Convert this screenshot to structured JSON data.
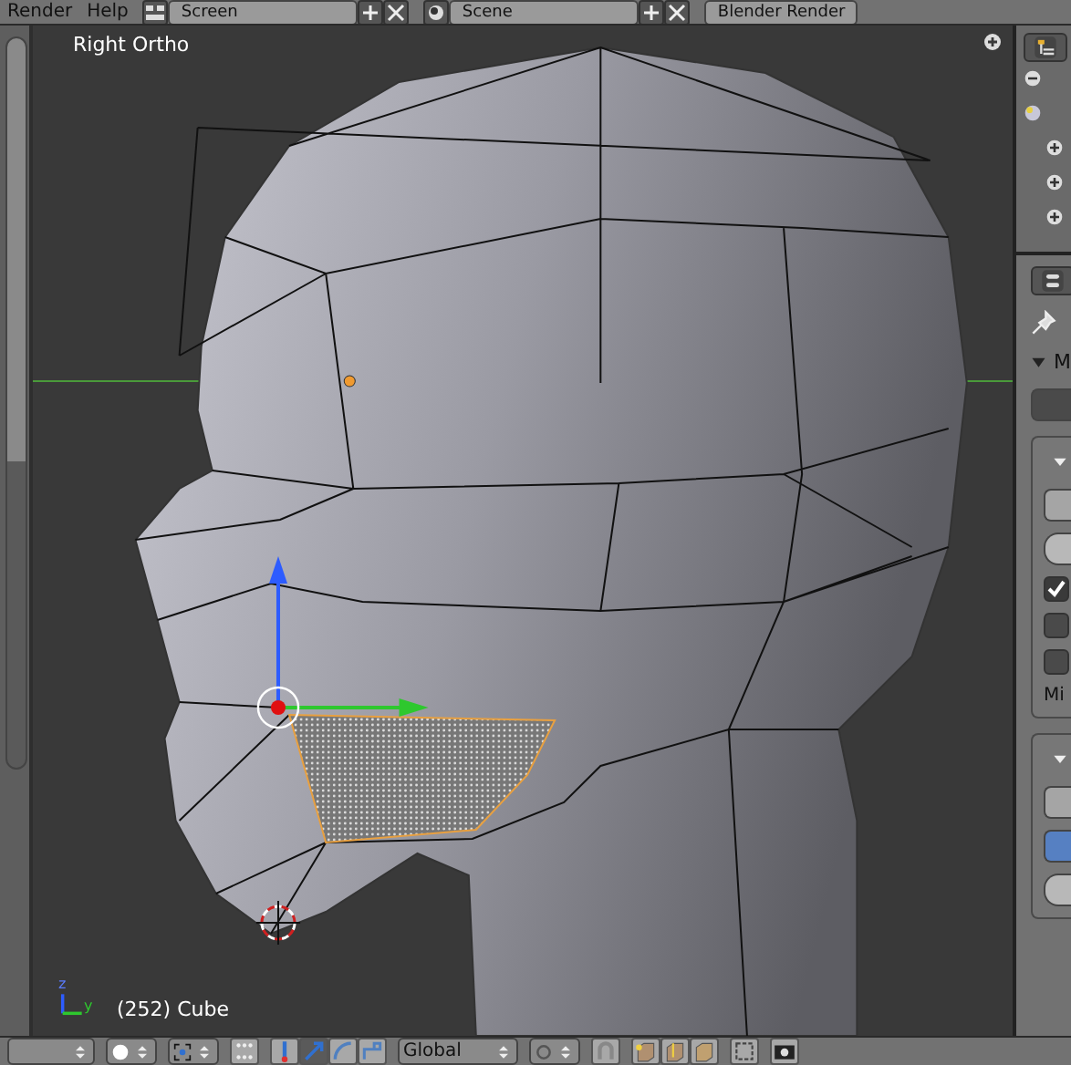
{
  "top_bar": {
    "menus": [
      "Render",
      "Help"
    ],
    "screen_layout": "Screen",
    "scene": "Scene",
    "render_engine": "Blender Render"
  },
  "viewport": {
    "view_name": "Right Ortho",
    "axis_labels": [
      "z",
      "y"
    ],
    "object_info": "(252) Cube"
  },
  "properties_panel": {
    "section_label": "M",
    "field_label": "Mi",
    "checkboxes": [
      {
        "checked": true
      },
      {
        "checked": false
      },
      {
        "checked": false
      }
    ]
  },
  "bottom_bar": {
    "transform_orientation": "Global",
    "manipulator_modes": [
      {
        "kind": "translate",
        "selected": true
      },
      {
        "kind": "rotate",
        "selected": false
      },
      {
        "kind": "scale",
        "selected": false
      }
    ]
  }
}
